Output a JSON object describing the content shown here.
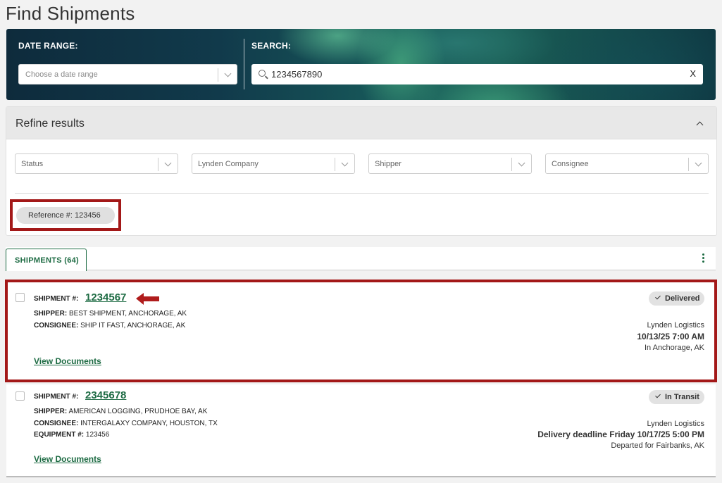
{
  "page": {
    "title": "Find Shipments"
  },
  "hero": {
    "date_label": "DATE RANGE:",
    "date_placeholder": "Choose a date range",
    "search_label": "SEARCH:",
    "search_value": "1234567890",
    "clear_label": "X"
  },
  "refine": {
    "title": "Refine results",
    "filters": [
      "Status",
      "Lynden Company",
      "Shipper",
      "Consignee"
    ],
    "chip": "Reference #: 123456"
  },
  "tabs": {
    "shipments_label": "SHIPMENTS (64)"
  },
  "shipments": [
    {
      "number_label": "SHIPMENT #:",
      "number": "1234567",
      "shipper_label": "SHIPPER:",
      "shipper": "BEST SHIPMENT, ANCHORAGE, AK",
      "consignee_label": "CONSIGNEE:",
      "consignee": "SHIP IT FAST, ANCHORAGE, AK",
      "status": "Delivered",
      "carrier": "Lynden Logistics",
      "date": "10/13/25 7:00 AM",
      "location": "In Anchorage, AK",
      "docs_label": "View Documents"
    },
    {
      "number_label": "SHIPMENT #:",
      "number": "2345678",
      "shipper_label": "SHIPPER:",
      "shipper": "AMERICAN LOGGING, PRUDHOE BAY, AK",
      "consignee_label": "CONSIGNEE:",
      "consignee": "INTERGALAXY COMPANY, HOUSTON, TX",
      "equipment_label": "EQUIPMENT #:",
      "equipment": "123456",
      "status": "In Transit",
      "carrier": "Lynden Logistics",
      "date": "Delivery deadline Friday 10/17/25 5:00 PM",
      "location": "Departed for Fairbanks, AK",
      "docs_label": "View Documents"
    }
  ],
  "colors": {
    "brand_green": "#1d6b43",
    "highlight_red": "#a31818"
  }
}
